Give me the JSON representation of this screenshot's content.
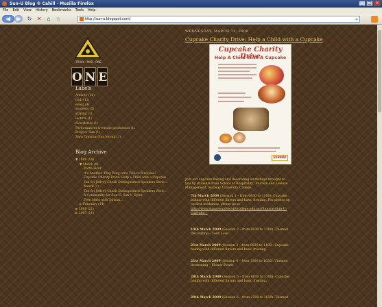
{
  "window": {
    "title": "Sun-U Blog ® Cahill - Mozilla Firefox",
    "controls": [
      "_",
      "□",
      "×"
    ]
  },
  "menu": [
    "File",
    "Edit",
    "View",
    "History",
    "Bookmarks",
    "Tools",
    "Help"
  ],
  "toolbar": {
    "url": "http://sun-u.blogspot.com/"
  },
  "sidebar": {
    "logo_caption": "TRULY · MAR · ONE",
    "one_letters": [
      "O",
      "N",
      "E"
    ],
    "labels_heading": "Labels",
    "labels": [
      "Activity (10)",
      "club (11)",
      "event (4)",
      "students (5)",
      "staying (1)",
      "lecture (1)",
      "Newsletter (1)",
      "Performances Overnite production (1)",
      "Project: Sun (1)",
      "Zero Creation Fun Month (1)"
    ],
    "archive_heading": "Blog Archive",
    "archive": [
      {
        "text": "▼ 2009 (14)",
        "level": 1
      },
      {
        "text": "▼ March (8)",
        "level": 2
      },
      {
        "text": "Earth Hour",
        "level": 3
      },
      {
        "text": "It's Another 'Ping Pong (ers) Trip to Malaysia!",
        "level": 3
      },
      {
        "text": "Cupcake Charity Drive: Help a Child with a Cupcake",
        "level": 3
      },
      {
        "text": "Tan Sri Jeffrey Cheah Distinguished Speakers Serie...",
        "level": 3
      },
      {
        "text": "Award (?)",
        "level": 3
      },
      {
        "text": "Tan Sri Jeffrey Cheah Distinguished Speakers Serie...",
        "level": 3
      },
      {
        "text": "A Community for Sun-U: Sun-U Spirit",
        "level": 3
      },
      {
        "text": "Free Meet with Taiwan...",
        "level": 3
      },
      {
        "text": "► February (14)",
        "level": 2
      },
      {
        "text": "► 2008 (21)",
        "level": 1
      },
      {
        "text": "► 2007 (11)",
        "level": 1
      }
    ]
  },
  "post": {
    "date": "WEDNESDAY, MARCH 11, 2009",
    "title": "Cupcake Charity Drive: Help a Child with a Cupcake",
    "poster": {
      "headline": "Cupcake Charity Drive",
      "subhead": "Help A Child With A Cupcake",
      "brand": "SUNWAY"
    },
    "intro": "Join our cupcake baking and decorating workshops brought to you by students from School of Hospitality, Tourism and Leisure Management, Sunway University College.",
    "link": "http://www.sunwayuniversitycollege.edu.my/Sunway/Sun-U-Cupcake...",
    "sessions": [
      {
        "date": "7th March 2009",
        "detail": "(Session 1 – from 0830 to 1100): Cupcake baking with different flavors and basic frosting. For photos up on first workshop, please go to"
      },
      {
        "date": "14th March 2009",
        "detail": "(Session 2 – from 0830 to 1100): Themed Decorating – Teen Love"
      },
      {
        "date": "21st March 2009",
        "detail": "(Session 3 – from 0830 to 1100): Cupcake baking with different flavors and basic frosting."
      },
      {
        "date": "21st March 2009",
        "detail": "(Session 4 – from 1300 to 1630): Themed decorating – Flower Power"
      },
      {
        "date": "28th March 2009",
        "detail": "(Session 5 – from 0830 to 1100): Cupcake baking with different flavors and basic frosting."
      },
      {
        "date": "28th March 2009",
        "detail": "(Session 6 – from 1300 to 1630): Themed"
      }
    ]
  }
}
